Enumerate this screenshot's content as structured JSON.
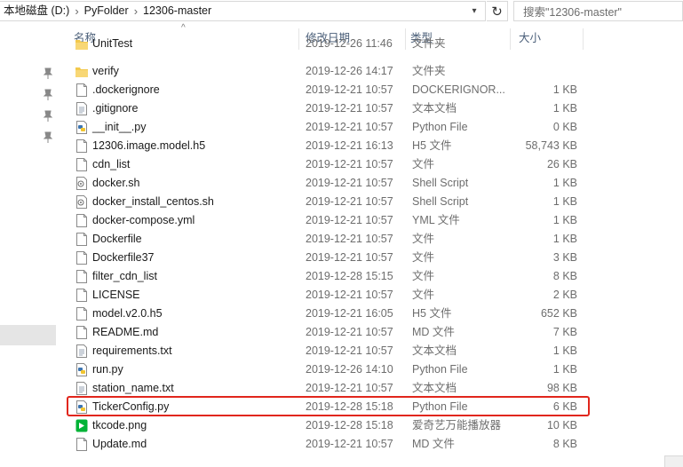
{
  "address": {
    "crumbs": [
      "本地磁盘 (D:)",
      "PyFolder",
      "12306-master"
    ],
    "search_placeholder": "搜索\"12306-master\""
  },
  "columns": {
    "name": "名称",
    "date": "修改日期",
    "type": "类型",
    "size": "大小"
  },
  "files": [
    {
      "name": "UnitTest",
      "date": "2019-12-26 11:46",
      "type": "文件夹",
      "size": "",
      "icon": "folder-icon"
    },
    {
      "name": "verify",
      "date": "2019-12-26 14:17",
      "type": "文件夹",
      "size": "",
      "icon": "folder-icon"
    },
    {
      "name": ".dockerignore",
      "date": "2019-12-21 10:57",
      "type": "DOCKERIGNOR...",
      "size": "1 KB",
      "icon": "file-icon"
    },
    {
      "name": ".gitignore",
      "date": "2019-12-21 10:57",
      "type": "文本文档",
      "size": "1 KB",
      "icon": "text-file-icon"
    },
    {
      "name": "__init__.py",
      "date": "2019-12-21 10:57",
      "type": "Python File",
      "size": "0 KB",
      "icon": "python-file-icon"
    },
    {
      "name": "12306.image.model.h5",
      "date": "2019-12-21 16:13",
      "type": "H5 文件",
      "size": "58,743 KB",
      "icon": "file-icon"
    },
    {
      "name": "cdn_list",
      "date": "2019-12-21 10:57",
      "type": "文件",
      "size": "26 KB",
      "icon": "file-icon"
    },
    {
      "name": "docker.sh",
      "date": "2019-12-21 10:57",
      "type": "Shell Script",
      "size": "1 KB",
      "icon": "shell-script-icon"
    },
    {
      "name": "docker_install_centos.sh",
      "date": "2019-12-21 10:57",
      "type": "Shell Script",
      "size": "1 KB",
      "icon": "shell-script-icon"
    },
    {
      "name": "docker-compose.yml",
      "date": "2019-12-21 10:57",
      "type": "YML 文件",
      "size": "1 KB",
      "icon": "file-icon"
    },
    {
      "name": "Dockerfile",
      "date": "2019-12-21 10:57",
      "type": "文件",
      "size": "1 KB",
      "icon": "file-icon"
    },
    {
      "name": "Dockerfile37",
      "date": "2019-12-21 10:57",
      "type": "文件",
      "size": "3 KB",
      "icon": "file-icon"
    },
    {
      "name": "filter_cdn_list",
      "date": "2019-12-28 15:15",
      "type": "文件",
      "size": "8 KB",
      "icon": "file-icon"
    },
    {
      "name": "LICENSE",
      "date": "2019-12-21 10:57",
      "type": "文件",
      "size": "2 KB",
      "icon": "file-icon"
    },
    {
      "name": "model.v2.0.h5",
      "date": "2019-12-21 16:05",
      "type": "H5 文件",
      "size": "652 KB",
      "icon": "file-icon"
    },
    {
      "name": "README.md",
      "date": "2019-12-21 10:57",
      "type": "MD 文件",
      "size": "7 KB",
      "icon": "file-icon"
    },
    {
      "name": "requirements.txt",
      "date": "2019-12-21 10:57",
      "type": "文本文档",
      "size": "1 KB",
      "icon": "text-file-icon"
    },
    {
      "name": "run.py",
      "date": "2019-12-26 14:10",
      "type": "Python File",
      "size": "1 KB",
      "icon": "python-file-icon"
    },
    {
      "name": "station_name.txt",
      "date": "2019-12-21 10:57",
      "type": "文本文档",
      "size": "98 KB",
      "icon": "text-file-icon"
    },
    {
      "name": "TickerConfig.py",
      "date": "2019-12-28 15:18",
      "type": "Python File",
      "size": "6 KB",
      "icon": "python-file-icon"
    },
    {
      "name": "tkcode.png",
      "date": "2019-12-28 15:18",
      "type": "爱奇艺万能播放器",
      "size": "10 KB",
      "icon": "image-file-icon"
    },
    {
      "name": "Update.md",
      "date": "2019-12-21 10:57",
      "type": "MD 文件",
      "size": "8 KB",
      "icon": "file-icon"
    }
  ],
  "highlight_row": "TickerConfig.py",
  "colors": {
    "highlight": "#e1261c",
    "folder": "#f3c94c",
    "header_text": "#4c607a"
  }
}
